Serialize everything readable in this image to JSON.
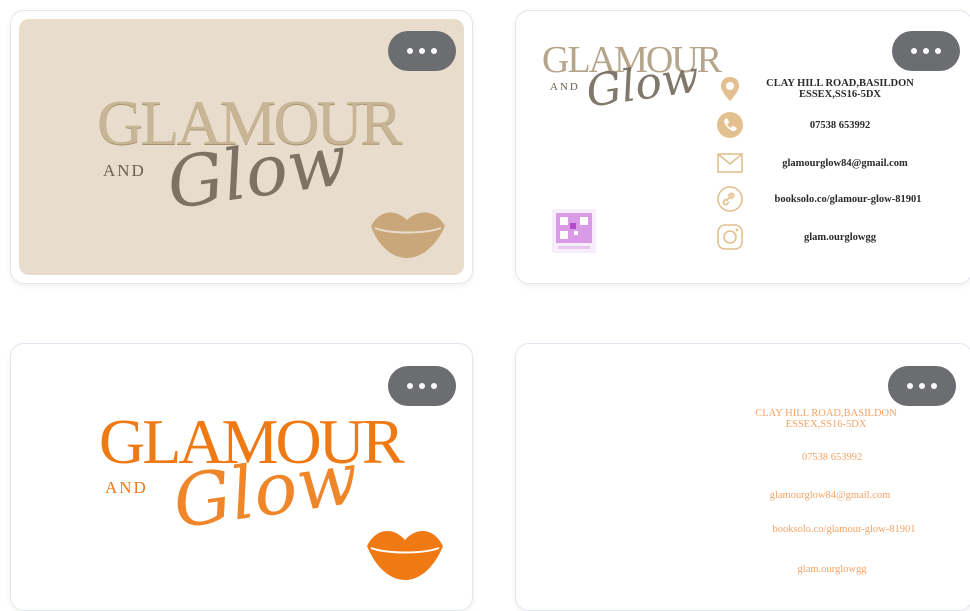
{
  "colors": {
    "beige_bg": "#e8ddcc",
    "gold_text": "#b39a78",
    "dark_script": "#6b6152",
    "orange": "#ef7a14",
    "peach_text": "#f4a365",
    "button_gray": "#6c6d70"
  },
  "brand": {
    "line1": "GLAMOUR",
    "line2": "AND",
    "script": "Glow"
  },
  "contact": {
    "address": "CLAY HILL ROAD,BASILDON\nESSEX,SS16-5DX",
    "phone": "07538 653992",
    "email": "glamourglow84@gmail.com",
    "website": "booksolo.co/glamour-glow-81901",
    "instagram": "glam.ourglowgg"
  },
  "icons": [
    "location-pin-icon",
    "phone-icon",
    "mail-icon",
    "link-icon",
    "instagram-icon",
    "more-icon"
  ],
  "more_button": {
    "label": "•••"
  }
}
